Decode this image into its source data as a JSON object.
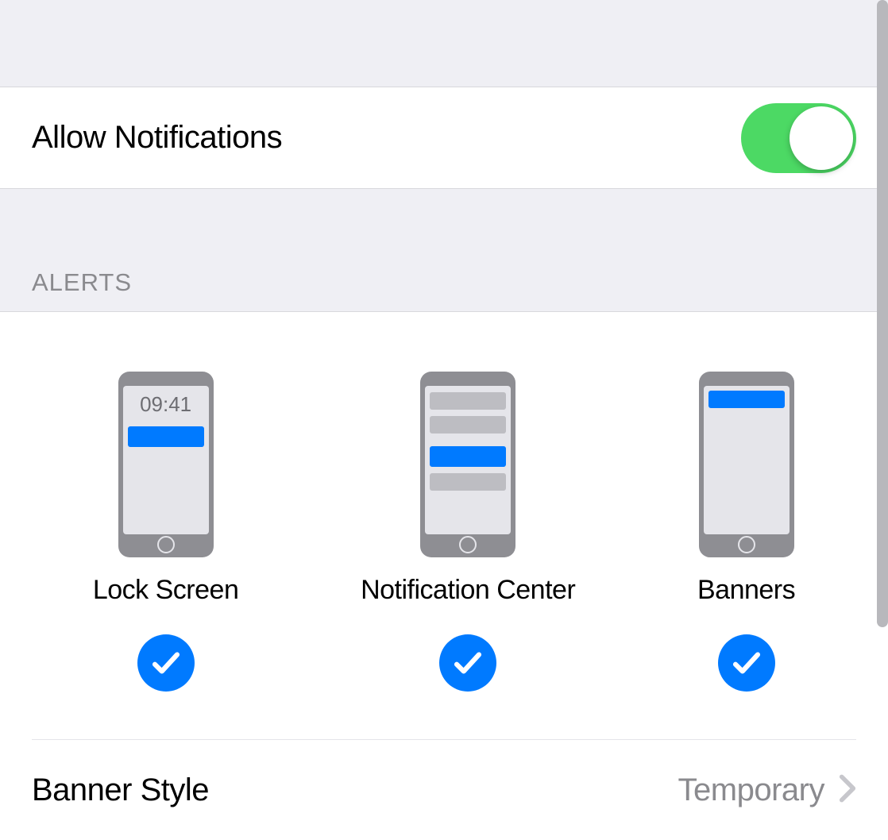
{
  "allow": {
    "label": "Allow Notifications",
    "enabled": true
  },
  "sections": {
    "alerts_header": "ALERTS"
  },
  "alert_options": {
    "lock_screen": {
      "label": "Lock Screen",
      "time": "09:41",
      "checked": true
    },
    "notification_center": {
      "label": "Notification Center",
      "checked": true
    },
    "banners": {
      "label": "Banners",
      "checked": true
    }
  },
  "banner_style": {
    "label": "Banner Style",
    "value": "Temporary"
  },
  "colors": {
    "accent": "#007aff",
    "toggle_on": "#4cd964"
  }
}
